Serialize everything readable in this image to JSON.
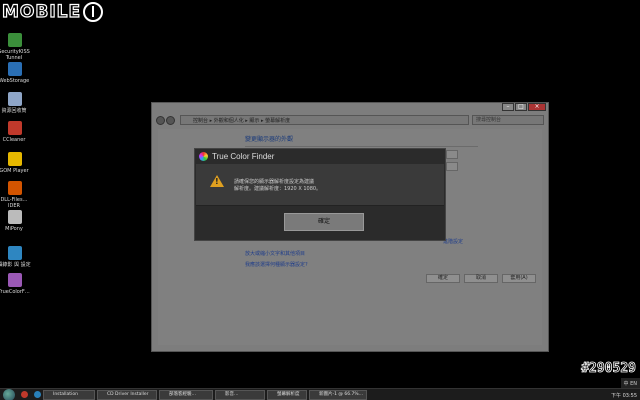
{
  "watermark": {
    "logo_text": "MOBILE",
    "post_number": "#290529"
  },
  "desktop_icons": [
    {
      "label": "SecurityKISS Tunnel",
      "color": "#3b8f3b"
    },
    {
      "label": "WebStorage",
      "color": "#2a6fb5"
    },
    {
      "label": "資源回收筒",
      "color": "#8fa6c8"
    },
    {
      "label": "CCleaner",
      "color": "#c0392b"
    },
    {
      "label": "GOM Player",
      "color": "#e6b800"
    },
    {
      "label": "DLL-Files… IDER",
      "color": "#d35400"
    },
    {
      "label": "MiPony",
      "color": "#bbbbbb"
    },
    {
      "label": "攝錄影 與 設定",
      "color": "#2e86c1"
    },
    {
      "label": "TrueColorF…",
      "color": "#9b59b6"
    }
  ],
  "explorer": {
    "breadcrumb": "控制台 ▸ 外觀和個人化 ▸ 顯示 ▸ 螢幕解析度",
    "search_placeholder": "搜尋控制台",
    "page_title": "變更顯示器的外觀",
    "links": [
      "進階設定",
      "放大或縮小文字和其他項目",
      "我應該選擇何種顯示器設定?"
    ],
    "buttons": {
      "ok": "確定",
      "cancel": "取消",
      "apply": "套用(A)"
    }
  },
  "dialog": {
    "title": "True Color Finder",
    "message_line1": "請確保您的顯示器解析度設定為建議",
    "message_line2": "解析度。建議解析度：1920 X 1080。",
    "ok_label": "確定"
  },
  "taskbar": {
    "items": [
      "Installation",
      "CD Driver Installer",
      "部落客經驗…",
      "影音…",
      "螢幕解析度",
      "新圖片-1 @ 66.7%…"
    ],
    "tray_text": "中 EN",
    "clock": "下午 03:55"
  }
}
